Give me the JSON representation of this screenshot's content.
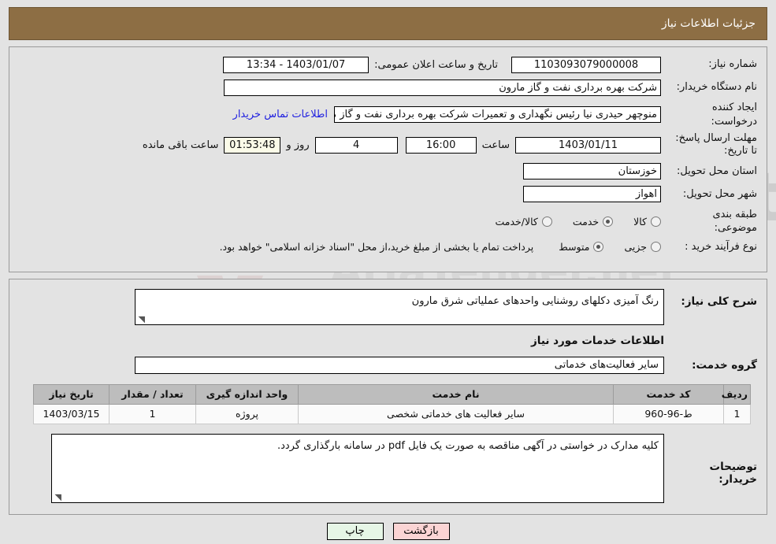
{
  "header": {
    "title": "جزئیات اطلاعات نیاز"
  },
  "info": {
    "need_number_label": "شماره نیاز:",
    "need_number_value": "1103093079000008",
    "public_announce_label": "تاریخ و ساعت اعلان عمومی:",
    "public_announce_value": "1403/01/07 - 13:34",
    "buyer_org_label": "نام دستگاه خریدار:",
    "buyer_org_value": "شرکت بهره برداری نفت و گاز مارون",
    "creator_label": "ایجاد کننده درخواست:",
    "creator_value": "منوچهر حیدری نیا رئیس نگهداری و تعمیرات شرکت بهره برداری نفت و گاز مارون",
    "contact_link": "اطلاعات تماس خریدار",
    "deadline_label": "مهلت ارسال پاسخ: تا تاریخ:",
    "deadline_date": "1403/01/11",
    "hour_label": "ساعت",
    "deadline_hour": "16:00",
    "days_value": "4",
    "days_and_label": "روز و",
    "countdown_value": "01:53:48",
    "remaining_label": "ساعت باقی مانده",
    "province_label": "استان محل تحویل:",
    "province_value": "خوزستان",
    "city_label": "شهر محل تحویل:",
    "city_value": "اهواز",
    "classification_label": "طبقه بندی موضوعی:",
    "classification_options": [
      {
        "label": "کالا",
        "selected": false
      },
      {
        "label": "خدمت",
        "selected": true
      },
      {
        "label": "کالا/خدمت",
        "selected": false
      }
    ],
    "process_label": "نوع فرآیند خرید :",
    "process_options": [
      {
        "label": "جزیی",
        "selected": false
      },
      {
        "label": "متوسط",
        "selected": true
      }
    ],
    "process_note": "پرداخت تمام یا بخشی از مبلغ خرید،از محل \"اسناد خزانه اسلامی\" خواهد بود."
  },
  "details": {
    "need_desc_label": "شرح کلی نیاز:",
    "need_desc_value": "رنگ آمیزی دکلهای روشنایی واحدهای عملیاتی شرق مارون",
    "services_section_title": "اطلاعات خدمات مورد نیاز",
    "service_group_label": "گروه خدمت:",
    "service_group_value": "سایر فعالیت‌های خدماتی",
    "table": {
      "columns": [
        "ردیف",
        "کد خدمت",
        "نام خدمت",
        "واحد اندازه گیری",
        "تعداد / مقدار",
        "تاریخ نیاز"
      ],
      "rows": [
        {
          "radif": "1",
          "code": "ط-96-960",
          "name": "سایر فعالیت های خدماتی شخصی",
          "unit": "پروژه",
          "qty": "1",
          "date": "1403/03/15"
        }
      ]
    },
    "buyer_comment_label": "توضیحات خریدار:",
    "buyer_comment_value": "کلیه مدارک در خواستی در آگهی مناقصه به صورت یک فایل pdf  در سامانه بارگذاری گردد."
  },
  "footer": {
    "back_label": "بازگشت",
    "print_label": "چاپ"
  },
  "colors": {
    "header_bar": "#8d6e44",
    "page_bg": "#e3e3e3",
    "link": "#1f1fe0",
    "table_header": "#bdbdbd",
    "btn_back": "#fbd4d4",
    "btn_print": "#e6f6e6",
    "countdown_bg": "#fbfbe8"
  },
  "watermark": {
    "text": "AriaTender.net"
  }
}
